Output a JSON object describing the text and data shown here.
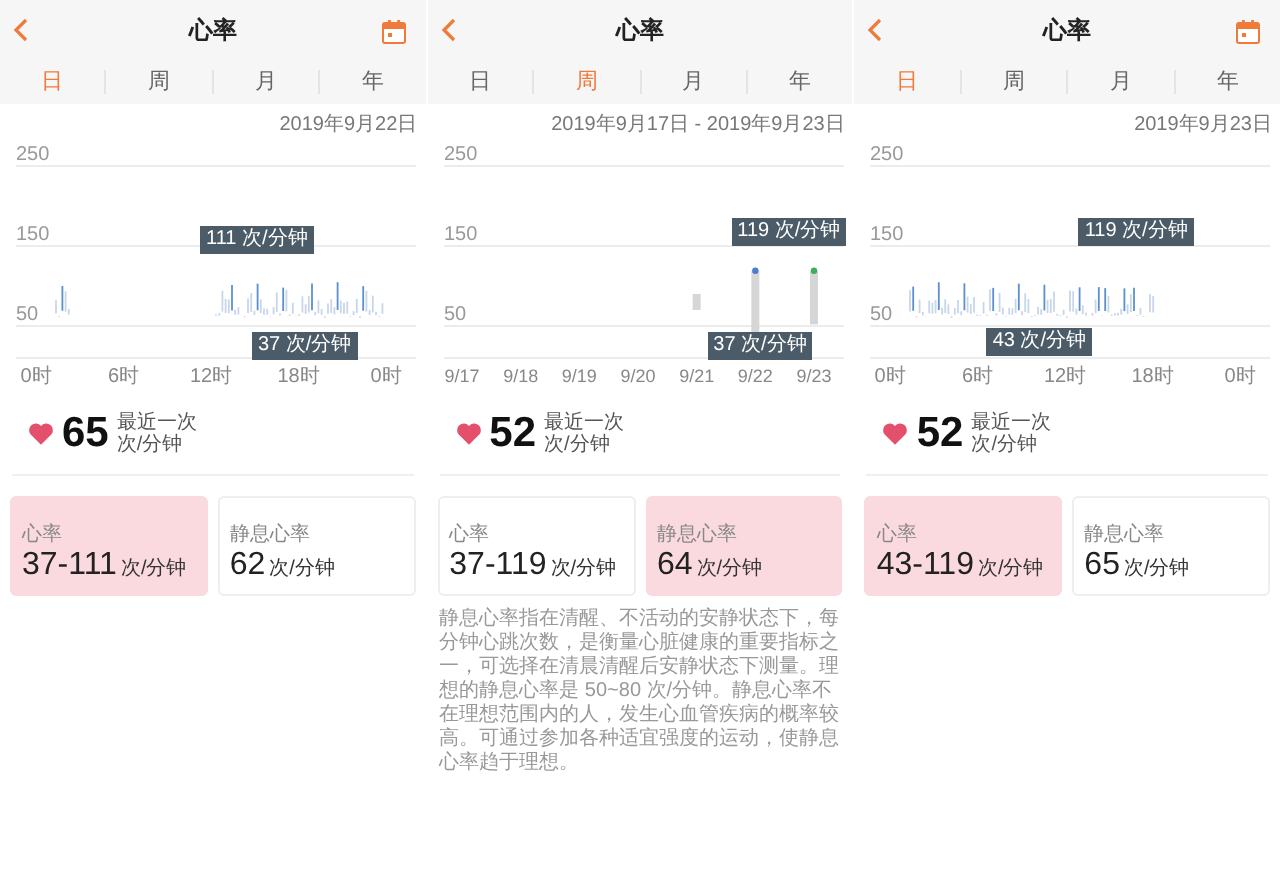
{
  "panels": [
    {
      "header": {
        "title": "心率",
        "calendar": true
      },
      "tabs": [
        {
          "label": "日",
          "selected": true
        },
        {
          "label": "周",
          "selected": false
        },
        {
          "label": "月",
          "selected": false
        },
        {
          "label": "年",
          "selected": false
        }
      ],
      "date": "2019年9月22日",
      "chart": {
        "kind": "day",
        "y_labels": [
          "250",
          "150",
          "50"
        ],
        "x_labels": [
          "0时",
          "6时",
          "12时",
          "18时",
          "0时"
        ],
        "max_tip": "111 次/分钟",
        "min_tip": "37 次/分钟"
      },
      "summary": {
        "value": "65",
        "caption": "最近一次",
        "unit": "次/分钟"
      },
      "cards": [
        {
          "label": "心率",
          "value": "37-111",
          "unit": "次/分钟",
          "selected": true
        },
        {
          "label": "静息心率",
          "value": "62",
          "unit": "次/分钟",
          "selected": false
        }
      ]
    },
    {
      "header": {
        "title": "心率",
        "calendar": false
      },
      "tabs": [
        {
          "label": "日",
          "selected": false
        },
        {
          "label": "周",
          "selected": true
        },
        {
          "label": "月",
          "selected": false
        },
        {
          "label": "年",
          "selected": false
        }
      ],
      "date": "2019年9月17日 - 2019年9月23日",
      "chart": {
        "kind": "week",
        "y_labels": [
          "250",
          "150",
          "50"
        ],
        "x_labels": [
          "9/17",
          "9/18",
          "9/19",
          "9/20",
          "9/21",
          "9/22",
          "9/23"
        ],
        "max_tip": "119 次/分钟",
        "min_tip": "37 次/分钟"
      },
      "summary": {
        "value": "52",
        "caption": "最近一次",
        "unit": "次/分钟"
      },
      "cards": [
        {
          "label": "心率",
          "value": "37-119",
          "unit": "次/分钟",
          "selected": false
        },
        {
          "label": "静息心率",
          "value": "64",
          "unit": "次/分钟",
          "selected": true
        }
      ],
      "description": "静息心率指在清醒、不活动的安静状态下，每分钟心跳次数，是衡量心脏健康的重要指标之一，可选择在清晨清醒后安静状态下测量。理想的静息心率是 50~80 次/分钟。静息心率不在理想范围内的人，发生心血管疾病的概率较高。可通过参加各种适宜强度的运动，使静息心率趋于理想。"
    },
    {
      "header": {
        "title": "心率",
        "calendar": true
      },
      "tabs": [
        {
          "label": "日",
          "selected": true
        },
        {
          "label": "周",
          "selected": false
        },
        {
          "label": "月",
          "selected": false
        },
        {
          "label": "年",
          "selected": false
        }
      ],
      "date": "2019年9月23日",
      "chart": {
        "kind": "day",
        "y_labels": [
          "250",
          "150",
          "50"
        ],
        "x_labels": [
          "0时",
          "6时",
          "12时",
          "18时",
          "0时"
        ],
        "max_tip": "119 次/分钟",
        "min_tip": "43 次/分钟"
      },
      "summary": {
        "value": "52",
        "caption": "最近一次",
        "unit": "次/分钟"
      },
      "cards": [
        {
          "label": "心率",
          "value": "43-119",
          "unit": "次/分钟",
          "selected": true
        },
        {
          "label": "静息心率",
          "value": "65",
          "unit": "次/分钟",
          "selected": false
        }
      ]
    }
  ]
}
